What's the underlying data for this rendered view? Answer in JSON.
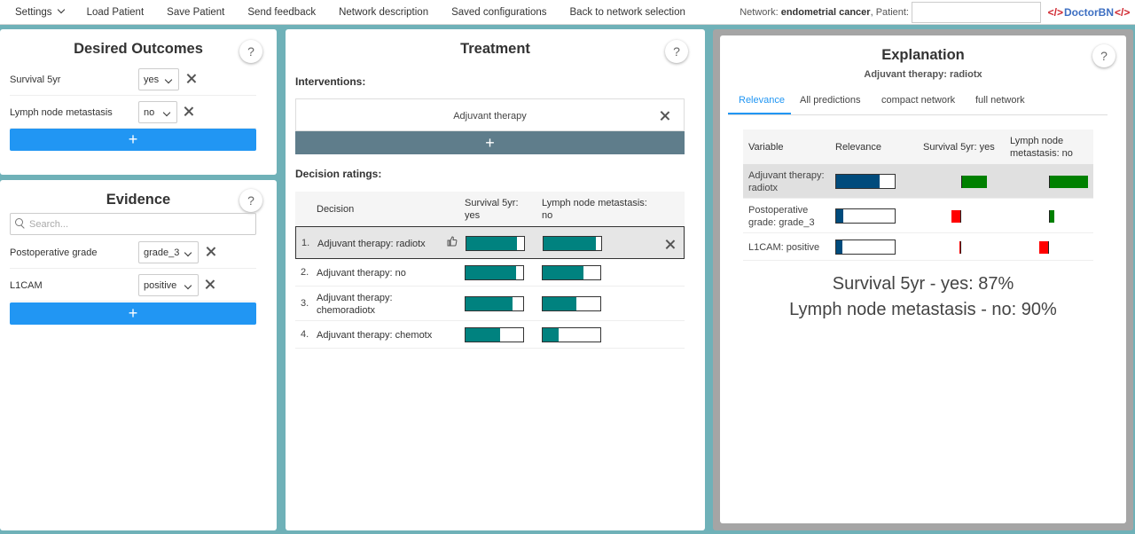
{
  "topbar": {
    "menu": [
      {
        "label": "Settings"
      },
      {
        "label": "Load Patient"
      },
      {
        "label": "Save Patient"
      },
      {
        "label": "Send feedback"
      },
      {
        "label": "Network description"
      },
      {
        "label": "Saved configurations"
      },
      {
        "label": "Back to network selection"
      }
    ],
    "network_prefix": "Network:",
    "network_name": "endometrial cancer",
    "patient_label": ", Patient:",
    "patient_value": "",
    "logo": {
      "left": "<",
      "mid": "/",
      "right": ">",
      "text": "DoctorBN",
      "end": "</>"
    }
  },
  "outcomes": {
    "title": "Desired Outcomes",
    "help": "?",
    "rows": [
      {
        "label": "Survival 5yr",
        "value": "yes"
      },
      {
        "label": "Lymph node metastasis",
        "value": "no"
      }
    ],
    "add": "+"
  },
  "evidence": {
    "title": "Evidence",
    "help": "?",
    "search_placeholder": "Search...",
    "rows": [
      {
        "label": "Postoperative grade",
        "value": "grade_3"
      },
      {
        "label": "L1CAM",
        "value": "positive"
      }
    ],
    "add": "+"
  },
  "treatment": {
    "title": "Treatment",
    "help": "?",
    "interventions_label": "Interventions:",
    "intervention": "Adjuvant therapy",
    "add": "+",
    "ratings_label": "Decision ratings:",
    "headers": {
      "decision": "Decision",
      "col1": [
        "Survival 5yr:",
        "yes"
      ],
      "col2": [
        "Lymph node metastasis:",
        "no"
      ]
    },
    "rows": [
      {
        "num": "1.",
        "decision": [
          "Adjuvant therapy: radiotx"
        ],
        "v1": 0.87,
        "v2": 0.9,
        "selected": true
      },
      {
        "num": "2.",
        "decision": [
          "Adjuvant therapy: no"
        ],
        "v1": 0.87,
        "v2": 0.7,
        "selected": false
      },
      {
        "num": "3.",
        "decision": [
          "Adjuvant therapy:",
          "chemoradiotx"
        ],
        "v1": 0.82,
        "v2": 0.59,
        "selected": false
      },
      {
        "num": "4.",
        "decision": [
          "Adjuvant therapy: chemotx"
        ],
        "v1": 0.6,
        "v2": 0.27,
        "selected": false
      }
    ]
  },
  "explanation": {
    "title": "Explanation",
    "subtitle": "Adjuvant therapy: radiotx",
    "help": "?",
    "tabs": [
      "Relevance",
      "All predictions",
      "compact network",
      "full network"
    ],
    "headers": {
      "variable": "Variable",
      "relevance": "Relevance",
      "col1": [
        "Survival 5yr: yes"
      ],
      "col2": [
        "Lymph node",
        "metastasis: no"
      ]
    },
    "rows": [
      {
        "variable": [
          "Adjuvant therapy:",
          "radiotx"
        ],
        "relevance": 0.74,
        "c1": 0.42,
        "c2": 0.65,
        "c1color": "#008000",
        "c2color": "#008000",
        "hl": true
      },
      {
        "variable": [
          "Postoperative",
          "grade: grade_3"
        ],
        "relevance": 0.12,
        "c1": -0.16,
        "c2": 0.09,
        "c1color": "#ff0000",
        "c2color": "#008000",
        "hl": false
      },
      {
        "variable": [
          "L1CAM: positive"
        ],
        "relevance": 0.1,
        "c1": -0.03,
        "c2": -0.16,
        "c1color": "#ff0000",
        "c2color": "#ff0000",
        "hl": false
      }
    ],
    "summary": [
      "Survival 5yr - yes: 87%",
      "Lymph node metastasis - no: 90%"
    ]
  }
}
